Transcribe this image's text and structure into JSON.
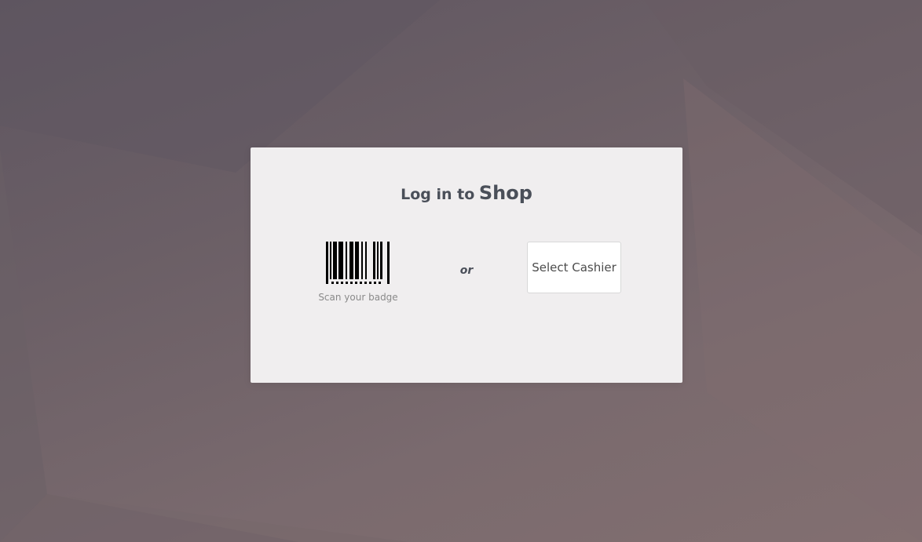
{
  "login": {
    "title_prefix": "Log in to",
    "title_shop": "Shop",
    "scan_label": "Scan your badge",
    "or_label": "or",
    "select_cashier_label": "Select Cashier"
  },
  "icons": {
    "barcode": "barcode-icon"
  },
  "colors": {
    "card_background": "#f0eeef",
    "title_text": "#4a4f59",
    "scan_text": "#8a8a8a",
    "background": "#6b5f66"
  }
}
